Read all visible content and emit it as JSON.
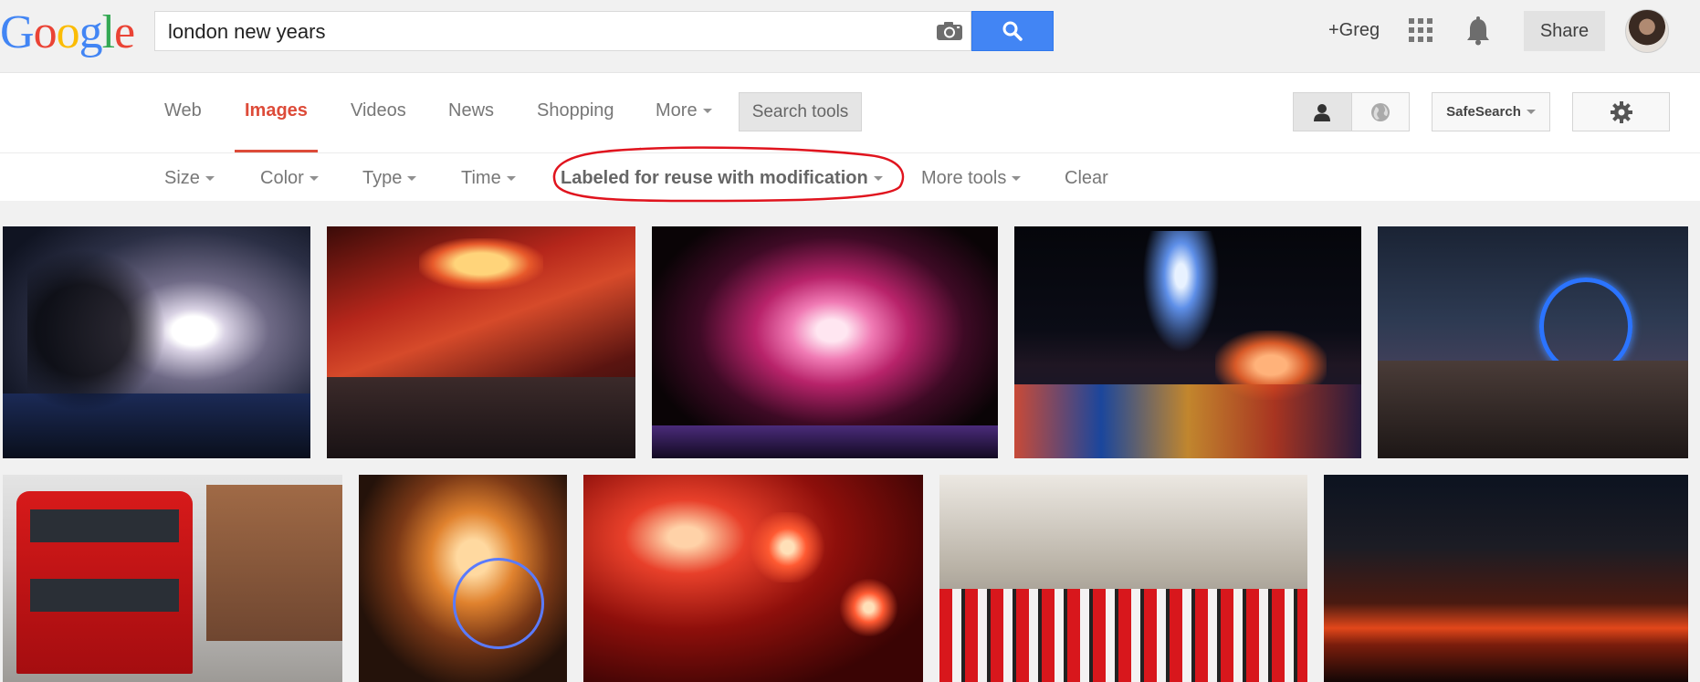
{
  "header": {
    "logo_text": "Google",
    "search_value": "london new years",
    "profile_link": "+Greg",
    "share_label": "Share"
  },
  "nav": {
    "items": [
      "Web",
      "Images",
      "Videos",
      "News",
      "Shopping",
      "More"
    ],
    "active": "Images",
    "search_tools_label": "Search tools",
    "safesearch_label": "SafeSearch"
  },
  "tools": {
    "items": [
      "Size",
      "Color",
      "Type",
      "Time",
      "Labeled for reuse with modification",
      "More tools",
      "Clear"
    ],
    "highlighted": "Labeled for reuse with modification",
    "highlight_color": "#e0141e"
  },
  "colors": {
    "accent_red": "#dd4b39",
    "search_blue": "#4285f4"
  },
  "results": [
    {
      "subject": "fireworks-tree-silhouette"
    },
    {
      "subject": "chinatown-gate-night"
    },
    {
      "subject": "fireworks-london-eye"
    },
    {
      "subject": "fireworks-over-water"
    },
    {
      "subject": "crowd-london-eye-blue"
    },
    {
      "subject": "red-double-decker-bus"
    },
    {
      "subject": "orange-fireworks-london-eye"
    },
    {
      "subject": "red-fireworks-close"
    },
    {
      "subject": "parade-marching-band"
    },
    {
      "subject": "sunset-horizon"
    }
  ]
}
